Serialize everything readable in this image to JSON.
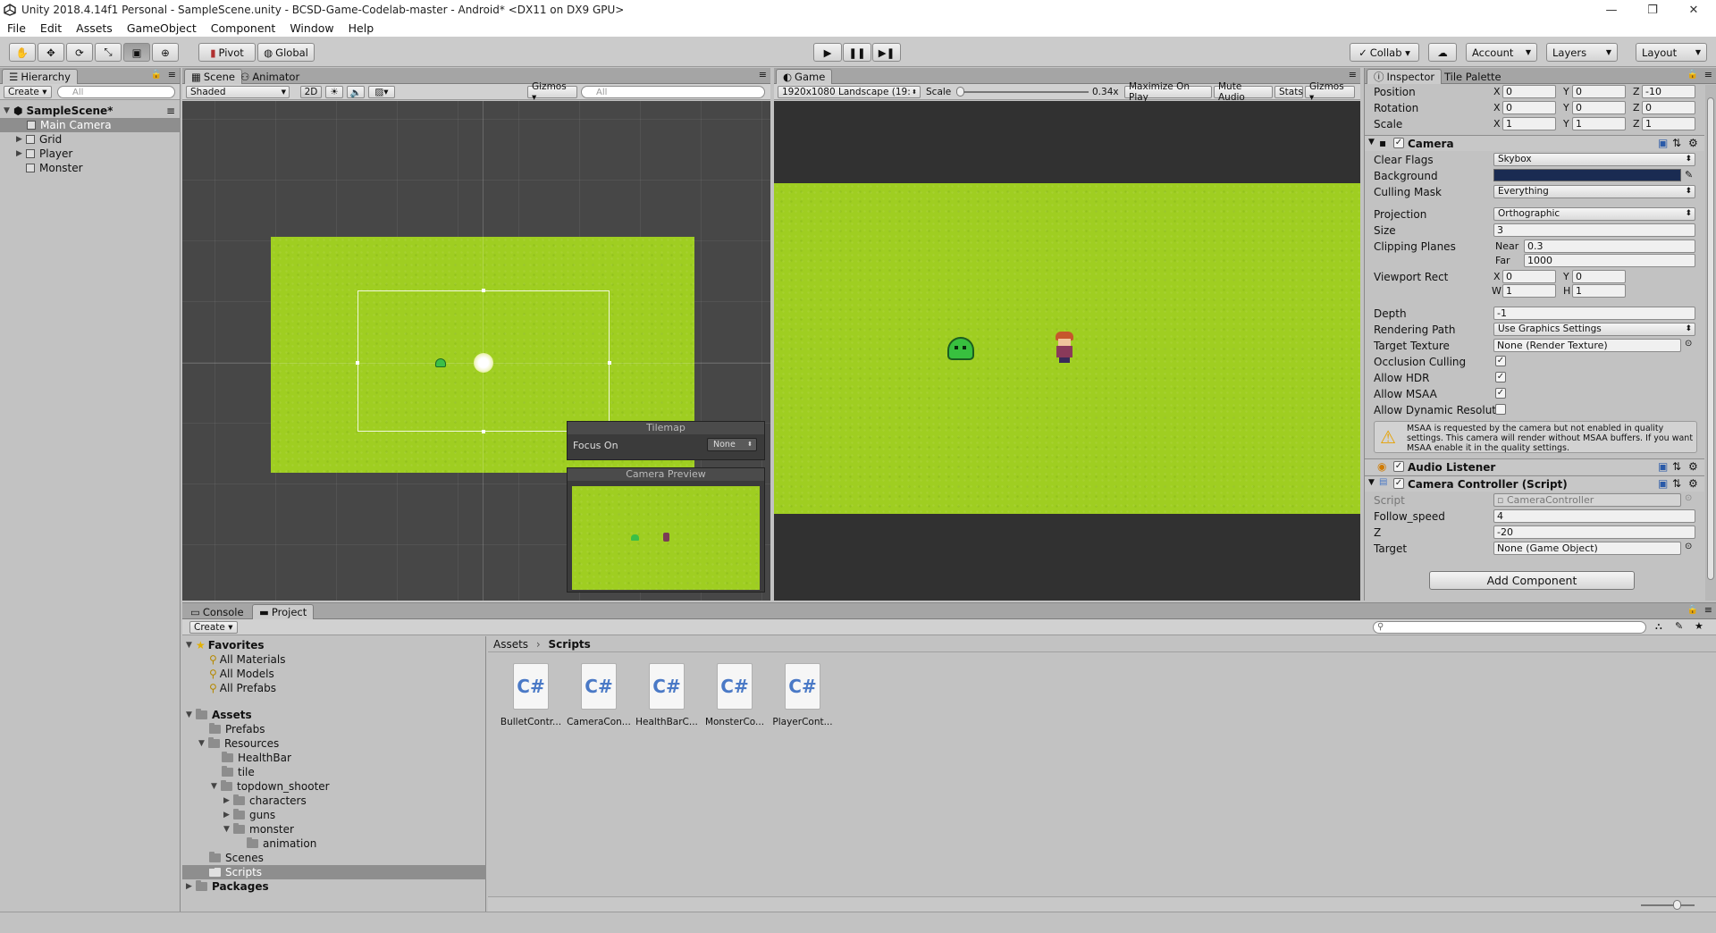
{
  "window": {
    "title": "Unity 2018.4.14f1 Personal - SampleScene.unity - BCSD-Game-Codelab-master - Android* <DX11 on DX9 GPU>"
  },
  "menu": [
    "File",
    "Edit",
    "Assets",
    "GameObject",
    "Component",
    "Window",
    "Help"
  ],
  "toolbar": {
    "pivot": "Pivot",
    "global": "Global",
    "collab": "Collab ▾",
    "account": "Account",
    "layers": "Layers",
    "layout": "Layout"
  },
  "hierarchy": {
    "tab": "Hierarchy",
    "create": "Create ▾",
    "search_placeholder": "All",
    "scene": "SampleScene*",
    "items": [
      "Main Camera",
      "Grid",
      "Player",
      "Monster"
    ]
  },
  "scene_view": {
    "tabs": [
      "Scene",
      "Animator"
    ],
    "shaded": "Shaded",
    "mode_2d": "2D",
    "gizmos": "Gizmos ▾",
    "search_placeholder": "All",
    "tilemap_overlay": {
      "title": "Tilemap",
      "focus_label": "Focus On",
      "focus_value": "None"
    },
    "camera_preview": {
      "title": "Camera Preview"
    }
  },
  "game_view": {
    "tab": "Game",
    "resolution": "1920x1080 Landscape (19:",
    "scale_label": "Scale",
    "scale_value": "0.34x",
    "maximize": "Maximize On Play",
    "mute": "Mute Audio",
    "stats": "Stats",
    "gizmos": "Gizmos ▾"
  },
  "inspector": {
    "tabs": [
      "Inspector",
      "Tile Palette"
    ],
    "transform": {
      "position": {
        "label": "Position",
        "x": "0",
        "y": "0",
        "z": "-10"
      },
      "rotation": {
        "label": "Rotation",
        "x": "0",
        "y": "0",
        "z": "0"
      },
      "scale": {
        "label": "Scale",
        "x": "1",
        "y": "1",
        "z": "1"
      }
    },
    "camera": {
      "title": "Camera",
      "clear_flags": {
        "label": "Clear Flags",
        "value": "Skybox"
      },
      "background": {
        "label": "Background",
        "color": "#1a2b52"
      },
      "culling_mask": {
        "label": "Culling Mask",
        "value": "Everything"
      },
      "projection": {
        "label": "Projection",
        "value": "Orthographic"
      },
      "size": {
        "label": "Size",
        "value": "3"
      },
      "clipping": {
        "label": "Clipping Planes",
        "near_label": "Near",
        "near": "0.3",
        "far_label": "Far",
        "far": "1000"
      },
      "viewport": {
        "label": "Viewport Rect",
        "x": "0",
        "y": "0",
        "w": "1",
        "h": "1"
      },
      "depth": {
        "label": "Depth",
        "value": "-1"
      },
      "rendering_path": {
        "label": "Rendering Path",
        "value": "Use Graphics Settings"
      },
      "target_texture": {
        "label": "Target Texture",
        "value": "None (Render Texture)"
      },
      "occlusion": "Occlusion Culling",
      "hdr": "Allow HDR",
      "msaa": "Allow MSAA",
      "dynres": "Allow Dynamic Resolut",
      "warning": "MSAA is requested by the camera but not enabled in quality settings. This camera will render without MSAA buffers. If you want MSAA enable it in the quality settings."
    },
    "audio_listener": {
      "title": "Audio Listener"
    },
    "camera_controller": {
      "title": "Camera Controller (Script)",
      "script": {
        "label": "Script",
        "value": "CameraController"
      },
      "follow_speed": {
        "label": "Follow_speed",
        "value": "4"
      },
      "z": {
        "label": "Z",
        "value": "-20"
      },
      "target": {
        "label": "Target",
        "value": "None (Game Object)"
      }
    },
    "add_component": "Add Component"
  },
  "bottom": {
    "tabs": [
      "Console",
      "Project"
    ],
    "create": "Create ▾",
    "favorites": {
      "label": "Favorites",
      "items": [
        "All Materials",
        "All Models",
        "All Prefabs"
      ]
    },
    "assets": {
      "label": "Assets",
      "tree": [
        {
          "name": "Prefabs",
          "depth": 1
        },
        {
          "name": "Resources",
          "depth": 1
        },
        {
          "name": "HealthBar",
          "depth": 2
        },
        {
          "name": "tile",
          "depth": 2
        },
        {
          "name": "topdown_shooter",
          "depth": 2
        },
        {
          "name": "characters",
          "depth": 3
        },
        {
          "name": "guns",
          "depth": 3
        },
        {
          "name": "monster",
          "depth": 3
        },
        {
          "name": "animation",
          "depth": 4
        },
        {
          "name": "Scenes",
          "depth": 1
        },
        {
          "name": "Scripts",
          "depth": 1
        }
      ]
    },
    "packages": "Packages",
    "breadcrumb": [
      "Assets",
      "Scripts"
    ],
    "files": [
      "BulletContr...",
      "CameraCon...",
      "HealthBarC...",
      "MonsterCo...",
      "PlayerCont..."
    ],
    "file_icon": "C#"
  },
  "colors": {
    "grass": "#9fce21",
    "dark_view": "#474747",
    "game_bg": "#313131"
  }
}
